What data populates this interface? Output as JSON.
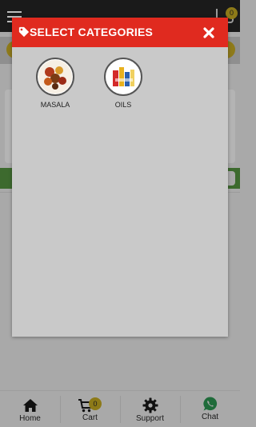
{
  "modal": {
    "title": "SELECT CATEGORIES",
    "categories": [
      {
        "label": "MASALA",
        "icon": "masala-spices-image"
      },
      {
        "label": "OILS",
        "icon": "oil-bottles-image"
      }
    ]
  },
  "bottom_nav": {
    "items": [
      {
        "label": "Home",
        "icon": "home-icon"
      },
      {
        "label": "Cart",
        "icon": "cart-icon",
        "badge": "0"
      },
      {
        "label": "Support",
        "icon": "gear-icon"
      },
      {
        "label": "Chat",
        "icon": "whatsapp-icon"
      }
    ]
  },
  "header": {
    "cart_badge": "0"
  },
  "colors": {
    "modal_header": "#e02a1f",
    "modal_body": "#c9c9c9",
    "overlay": "#a9a9a9",
    "badge": "#8d7a18"
  }
}
